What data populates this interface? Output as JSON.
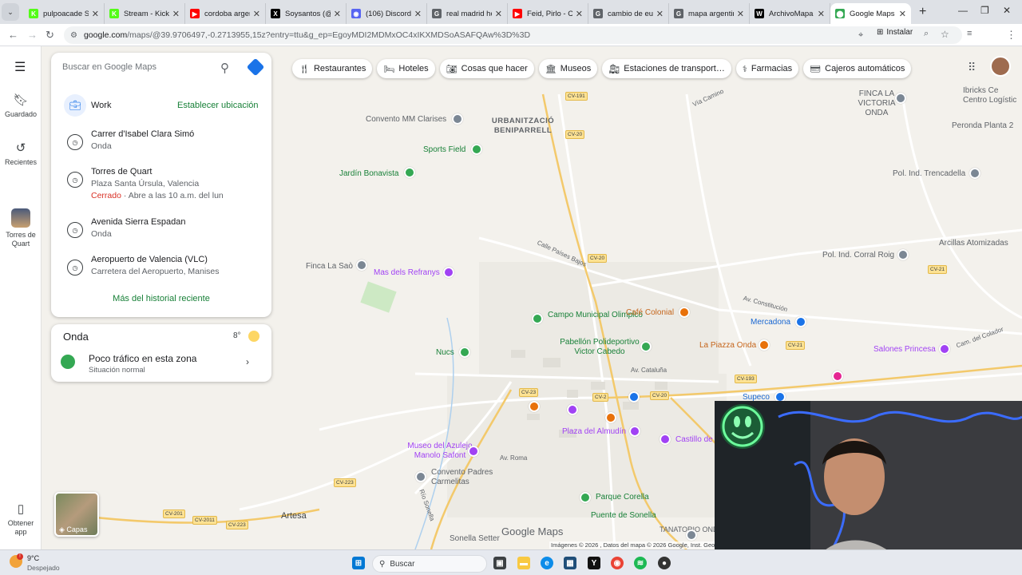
{
  "browser": {
    "tabs": [
      {
        "title": "pulpoacade St",
        "color": "#53fc18",
        "glyph": "K"
      },
      {
        "title": "Stream - Kick",
        "color": "#53fc18",
        "glyph": "K"
      },
      {
        "title": "cordoba argen",
        "color": "#ff0000",
        "glyph": "▶"
      },
      {
        "title": "Soysantos (@",
        "color": "#000000",
        "glyph": "X"
      },
      {
        "title": "(106) Discord",
        "color": "#5865f2",
        "glyph": "◉"
      },
      {
        "title": "real madrid hc",
        "color": "#5f6368",
        "glyph": "G"
      },
      {
        "title": "Feid, Pirlo - Cu",
        "color": "#ff0000",
        "glyph": "▶"
      },
      {
        "title": "cambio de eu",
        "color": "#5f6368",
        "glyph": "G"
      },
      {
        "title": "mapa argentin",
        "color": "#5f6368",
        "glyph": "G"
      },
      {
        "title": "ArchivoMapa",
        "color": "#000000",
        "glyph": "W"
      },
      {
        "title": "Google Maps",
        "color": "#34a853",
        "glyph": "⬤"
      }
    ],
    "url_host": "google.com",
    "url_path": "/maps/@39.9706497,-0.2713955,15z?entry=ttu&g_ep=EgoyMDI2MDMxOC4xIKXMDSoASAFQAw%3D%3D",
    "install_label": "Instalar"
  },
  "rail": {
    "saved": "Guardado",
    "recent": "Recientes",
    "place": "Torres de Quart",
    "app": "Obtener app",
    "layers": "Capas"
  },
  "search": {
    "placeholder": "Buscar en Google Maps"
  },
  "work": {
    "label": "Work",
    "action": "Establecer ubicación"
  },
  "recent_items": [
    {
      "title": "Carrer d'Isabel Clara Simó",
      "sub": "Onda"
    },
    {
      "title": "Torres de Quart",
      "sub": "Plaza Santa Úrsula, Valencia",
      "status": "Cerrado",
      "hours": " · Abre a las 10 a.m. del lun"
    },
    {
      "title": "Avenida Sierra Espadan",
      "sub": "Onda"
    },
    {
      "title": "Aeropuerto de Valencia (VLC)",
      "sub": "Carretera del Aeropuerto, Manises"
    }
  ],
  "more_history": "Más del historial reciente",
  "onda_card": {
    "city": "Onda",
    "temp": "8°",
    "traffic": "Poco tráfico en esta zona",
    "traffic_sub": "Situación normal"
  },
  "chips": [
    "Restaurantes",
    "Hoteles",
    "Cosas que hacer",
    "Museos",
    "Estaciones de transport…",
    "Farmacias",
    "Cajeros automáticos"
  ],
  "map_labels": {
    "urbanizacio": "URBANITZACIÓ BENIPARRELL",
    "convento": "Convento MM Clarises",
    "sports": "Sports Field",
    "jardin": "Jardín Bonavista",
    "finca_sao": "Finca La Saò",
    "refranys": "Mas dels Refranys",
    "campo": "Campo Municipal Olimpico",
    "cafe": "Café Colonial",
    "nucs": "Nucs",
    "pabellon": "Pabellón Polideportivo Victor Cabedo",
    "piazza": "La Piazza Onda",
    "mercadona": "Mercadona",
    "salones": "Salones Princesa",
    "plaza": "Plaza del Almudín",
    "castillo": "Castillo de",
    "museo": "Museo del Azulejo Manolo Safont",
    "carmelitas": "Convento Padres Carmelitas",
    "parque": "Parque Corella",
    "puente": "Puente de Sonella",
    "artesa": "Artesa",
    "sonella": "Sonella Setter",
    "tanatorio": "TANATORIO ONDA MARCO",
    "finca_victoria": "FINCA LA VICTORIA ONDA",
    "ibricks": "Ibricks Ce Centro Logístic",
    "peronda": "Peronda Planta 2",
    "trencadella": "Pol. Ind. Trencadella",
    "arcillas": "Arcillas Atomizadas",
    "corral": "Pol. Ind. Corral Roig",
    "supeco": "Supeco",
    "via_camino": "Vía Camino",
    "paises": "Calle Países Bajos",
    "constitucion": "Av. Constitución",
    "cataluna": "Av. Cataluña",
    "roma": "Av. Roma",
    "colador": "Cam. del Colador",
    "rio": "Río Sonella",
    "google_maps": "Google Maps",
    "attrib": "Imágenes © 2026 , Datos del mapa © 2026 Google, Inst. Geogr."
  },
  "road_shields": [
    "CV-191",
    "CV-20",
    "CV-20",
    "CV-21",
    "CV-21",
    "CV-193",
    "CV-23",
    "CV-2",
    "CV-20",
    "CV-223",
    "CV-201",
    "CV-2011",
    "CV-223"
  ],
  "taskbar": {
    "weather_temp": "9°C",
    "weather_desc": "Despejado",
    "search": "Buscar"
  }
}
